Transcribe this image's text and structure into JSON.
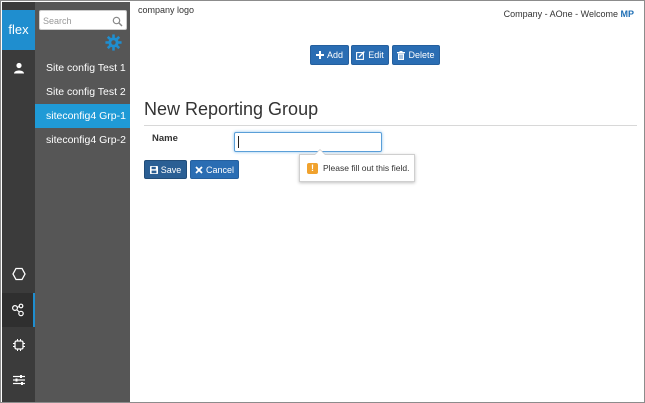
{
  "brand": {
    "label": "flex",
    "color": "#1f8ecf"
  },
  "sidebar": {
    "search_placeholder": "Search",
    "items": [
      {
        "label": "Site config Test 1",
        "active": false
      },
      {
        "label": "Site config Test 2",
        "active": false
      },
      {
        "label": "siteconfig4 Grp-1",
        "active": true
      },
      {
        "label": "siteconfig4 Grp-2",
        "active": false
      }
    ]
  },
  "rail_icons": [
    "user-icon",
    "hexagon-icon",
    "network-icon",
    "chip-icon",
    "sliders-icon"
  ],
  "header": {
    "logo_text": "company logo",
    "company_text": "Company - AOne - Welcome",
    "user_initials": "MP"
  },
  "toolbar": {
    "add_label": "Add",
    "edit_label": "Edit",
    "delete_label": "Delete"
  },
  "form": {
    "title": "New Reporting Group",
    "name_label": "Name",
    "name_value": "",
    "save_label": "Save",
    "cancel_label": "Cancel",
    "validation_message": "Please fill out this field.",
    "validation_icon": "!"
  },
  "colors": {
    "accent": "#1f9ad6",
    "button": "#2a6db3",
    "rail": "#3b3b3b",
    "sidebar": "#565656",
    "warning": "#f0a22e"
  }
}
